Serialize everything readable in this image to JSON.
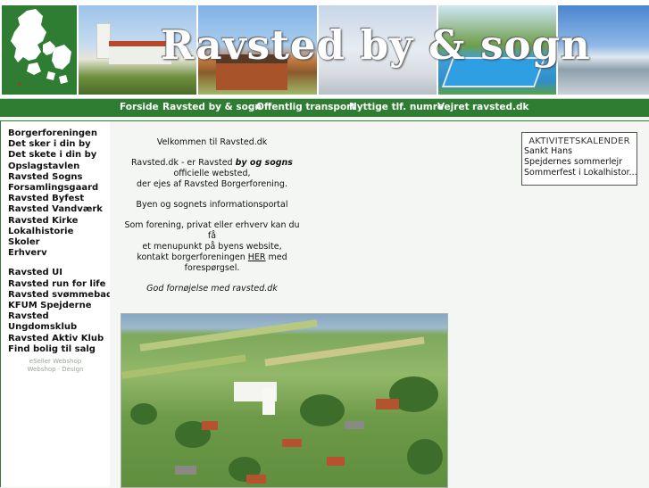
{
  "header": {
    "title": "Ravsted by & sogn"
  },
  "topnav": {
    "items": [
      "Forside",
      "Ravsted by & sogn",
      "Offentlig transport",
      "Nyttige tlf. numre",
      "Vejret",
      "ravsted.dk"
    ]
  },
  "sidebar": {
    "items": [
      "Borgerforeningen",
      "Det sker i din by",
      "Det skete i din by",
      "Opslagstavlen",
      "Ravsted Sogns",
      "Forsamlingsgaard",
      "Ravsted Byfest",
      "Ravsted Vandværk",
      "Ravsted Kirke",
      "Lokalhistorie",
      "Skoler",
      "Erhverv"
    ],
    "items2": [
      "Ravsted UI",
      "Ravsted run for life",
      "Ravsted svømmebad",
      "KFUM Spejderne",
      "Ravsted",
      "Ungdomsklub",
      "Ravsted Aktiv Klub",
      "Find bolig til salg"
    ],
    "credit_line1": "eSeller Webshop",
    "credit_line2": "Webshop · Design"
  },
  "welcome": {
    "greeting": "Velkommen til Ravsted.dk",
    "line1_a": "Ravsted.dk  - er Ravsted ",
    "line1_b": "by og sogns",
    "line2": "officielle websted,",
    "line3": "der ejes af Ravsted Borgerforening.",
    "line4": "Byen og sognets  informationsportal",
    "line5": "Som forening, privat eller erhverv kan du få",
    "line6": "et menupunkt på byens website,",
    "line7_a": "kontakt borgerforeningen ",
    "line7_link": "HER",
    "line7_b": "  med",
    "line8": "forespørgsel.",
    "closing": "God fornøjelse med ravsted.dk"
  },
  "calendar": {
    "title": "AKTIVITETSKALENDER",
    "events": [
      "Sankt Hans",
      "Spejdernes sommerlejr",
      "Sommerfest i Lokalhistor..."
    ]
  },
  "colors": {
    "brand_green": "#2e7d32",
    "nav_text": "#ffffff"
  }
}
